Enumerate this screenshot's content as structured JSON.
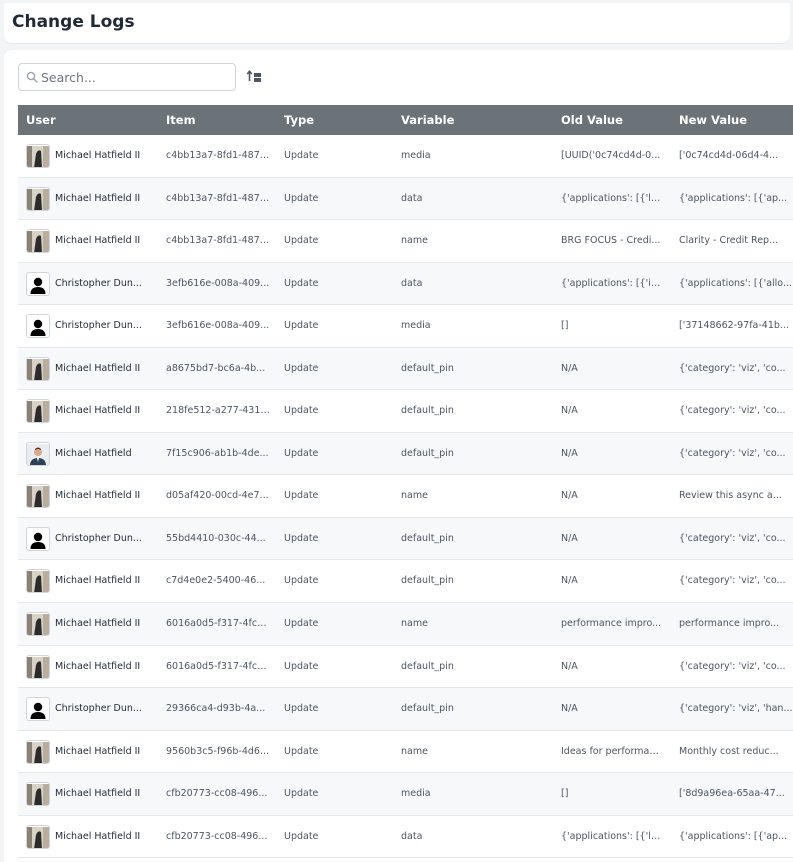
{
  "page": {
    "title": "Change Logs"
  },
  "search": {
    "placeholder": "Search..."
  },
  "table": {
    "columns": [
      "User",
      "Item",
      "Type",
      "Variable",
      "Old Value",
      "New Value"
    ],
    "rows": [
      {
        "user": "Michael Hatfield II",
        "avatar": "photo-dark",
        "item": "c4bb13a7-8fd1-4875...",
        "type": "Update",
        "variable": "media",
        "old": "[UUID('0c74cd4d-0...",
        "new": "['0c74cd4d-06d4-4..."
      },
      {
        "user": "Michael Hatfield II",
        "avatar": "photo-dark",
        "item": "c4bb13a7-8fd1-4875...",
        "type": "Update",
        "variable": "data",
        "old": "{'applications': [{'lay...",
        "new": "{'applications': [{'ap..."
      },
      {
        "user": "Michael Hatfield II",
        "avatar": "photo-dark",
        "item": "c4bb13a7-8fd1-4875...",
        "type": "Update",
        "variable": "name",
        "old": "BRG FOCUS - Credi...",
        "new": "Clarity - Credit Rep..."
      },
      {
        "user": "Christopher Dun...",
        "avatar": "person-silhouette",
        "item": "3efb616e-008a-409...",
        "type": "Update",
        "variable": "data",
        "old": "{'applications': [{'id':...",
        "new": "{'applications': [{'allo..."
      },
      {
        "user": "Christopher Dun...",
        "avatar": "person-silhouette",
        "item": "3efb616e-008a-409...",
        "type": "Update",
        "variable": "media",
        "old": "[]",
        "new": "['37148662-97fa-41b..."
      },
      {
        "user": "Michael Hatfield II",
        "avatar": "photo-dark",
        "item": "a8675bd7-bc6a-4b...",
        "type": "Update",
        "variable": "default_pin",
        "old": "N/A",
        "new": "{'category': 'viz', 'co..."
      },
      {
        "user": "Michael Hatfield II",
        "avatar": "photo-dark",
        "item": "218fe512-a277-431a-...",
        "type": "Update",
        "variable": "default_pin",
        "old": "N/A",
        "new": "{'category': 'viz', 'co..."
      },
      {
        "user": "Michael Hatfield",
        "avatar": "photo-portrait",
        "item": "7f15c906-ab1b-4de...",
        "type": "Update",
        "variable": "default_pin",
        "old": "N/A",
        "new": "{'category': 'viz', 'co..."
      },
      {
        "user": "Michael Hatfield II",
        "avatar": "photo-dark",
        "item": "d05af420-00cd-4e7...",
        "type": "Update",
        "variable": "name",
        "old": "N/A",
        "new": "Review this async a..."
      },
      {
        "user": "Christopher Dun...",
        "avatar": "person-silhouette",
        "item": "55bd4410-030c-44...",
        "type": "Update",
        "variable": "default_pin",
        "old": "N/A",
        "new": "{'category': 'viz', 'co..."
      },
      {
        "user": "Michael Hatfield II",
        "avatar": "photo-dark",
        "item": "c7d4e0e2-5400-46...",
        "type": "Update",
        "variable": "default_pin",
        "old": "N/A",
        "new": "{'category': 'viz', 'co..."
      },
      {
        "user": "Michael Hatfield II",
        "avatar": "photo-dark",
        "item": "6016a0d5-f317-4fc4-...",
        "type": "Update",
        "variable": "name",
        "old": "performance impro...",
        "new": "performance impro..."
      },
      {
        "user": "Michael Hatfield II",
        "avatar": "photo-dark",
        "item": "6016a0d5-f317-4fc4-...",
        "type": "Update",
        "variable": "default_pin",
        "old": "N/A",
        "new": "{'category': 'viz', 'co..."
      },
      {
        "user": "Christopher Dun...",
        "avatar": "person-silhouette",
        "item": "29366ca4-d93b-4a...",
        "type": "Update",
        "variable": "default_pin",
        "old": "N/A",
        "new": "{'category': 'viz', 'han..."
      },
      {
        "user": "Michael Hatfield II",
        "avatar": "photo-dark",
        "item": "9560b3c5-f96b-4d6...",
        "type": "Update",
        "variable": "name",
        "old": "Ideas for performan...",
        "new": "Monthly cost reduc..."
      },
      {
        "user": "Michael Hatfield II",
        "avatar": "photo-dark",
        "item": "cfb20773-cc08-496...",
        "type": "Update",
        "variable": "media",
        "old": "[]",
        "new": "['8d9a96ea-65aa-47..."
      },
      {
        "user": "Michael Hatfield II",
        "avatar": "photo-dark",
        "item": "cfb20773-cc08-496...",
        "type": "Update",
        "variable": "data",
        "old": "{'applications': [{'lay...",
        "new": "{'applications': [{'ap..."
      }
    ]
  },
  "colors": {
    "header_bg": "#6b7278",
    "row_alt_bg": "#f6f8fa",
    "page_bg": "#f3f4f6"
  }
}
